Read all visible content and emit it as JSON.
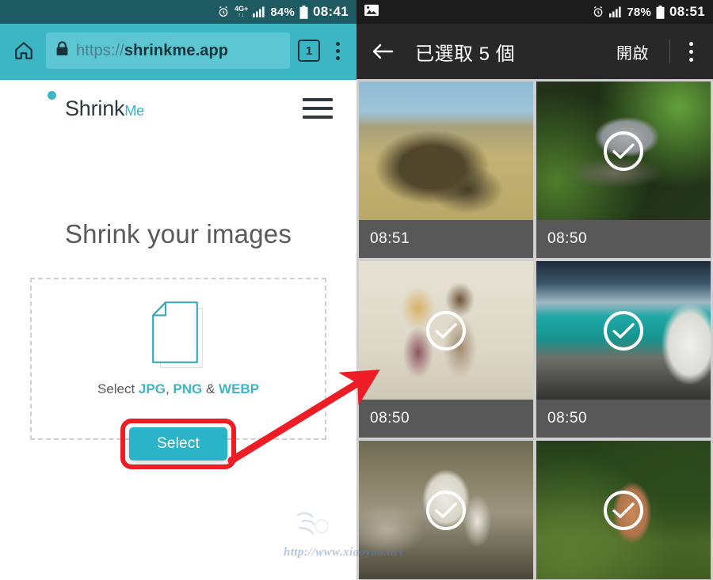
{
  "left_panel": {
    "status_bar": {
      "alarm_icon": "alarm-clock-icon",
      "network_label": "4G+",
      "network_arrows": "↑↓",
      "signal_icon": "signal-bars-icon",
      "battery_percent": "84%",
      "battery_icon": "battery-icon",
      "time": "08:41"
    },
    "browser_bar": {
      "home_icon": "home-icon",
      "lock_icon": "lock-icon",
      "url_scheme": "https://",
      "url_host": "shrinkme.app",
      "tab_count": "1",
      "menu_icon": "kebab-menu-icon"
    },
    "site": {
      "brand_name": "Shrink",
      "brand_suffix": "Me",
      "logo_icon": "shrinkme-logo-icon",
      "menu_icon": "hamburger-menu-icon",
      "hero_title": "Shrink your images",
      "dropzone": {
        "file_icon": "document-file-icon",
        "label_prefix": "Select ",
        "format_jpg": "JPG",
        "label_sep1": ", ",
        "format_png": "PNG",
        "label_sep2": " & ",
        "format_webp": "WEBP",
        "select_button": "Select"
      }
    }
  },
  "right_panel": {
    "status_bar": {
      "image_icon": "photo-notification-icon",
      "alarm_icon": "alarm-clock-icon",
      "signal_icon": "signal-bars-icon",
      "battery_percent": "78%",
      "battery_icon": "battery-icon",
      "time": "08:51"
    },
    "app_bar": {
      "back_icon": "back-arrow-icon",
      "title": "已選取 5 個",
      "open_button": "開啟",
      "menu_icon": "kebab-menu-icon"
    },
    "gallery": [
      {
        "name": "elephant-photo",
        "art": "art-elephant",
        "time": "08:51",
        "selected": false,
        "alt": "African elephant on savanna grassland"
      },
      {
        "name": "bird-photo",
        "art": "art-bird",
        "time": "08:50",
        "selected": true,
        "alt": "Small bird perched on mossy branch"
      },
      {
        "name": "children-photo",
        "art": "art-kids",
        "time": "08:50",
        "selected": true,
        "alt": "Two children standing together"
      },
      {
        "name": "lake-dog-photo",
        "art": "art-lake",
        "time": "08:50",
        "selected": true,
        "alt": "White dog beside turquoise mountain lake"
      },
      {
        "name": "white-tiger-photo",
        "art": "art-tiger",
        "time": "",
        "selected": true,
        "alt": "White tiger with woman on rocks"
      },
      {
        "name": "fox-photo",
        "art": "art-fox",
        "time": "",
        "selected": true,
        "alt": "Red fox in green meadow"
      }
    ],
    "check_icon": "checkmark-circle-icon"
  },
  "annotations": {
    "arrow_icon": "red-arrow-annotation",
    "highlight_icon": "red-highlight-box",
    "accent_red": "#ee1c25"
  },
  "watermark": {
    "text": "http://www.xiaoyao.net"
  },
  "colors": {
    "browser_teal": "#3cb5c4",
    "status_dark_teal": "#1e5a61",
    "appbar_dark": "#282828",
    "caption_gray": "#585858",
    "accent": "#2bb3c8",
    "annotation_red": "#ee1c25"
  }
}
